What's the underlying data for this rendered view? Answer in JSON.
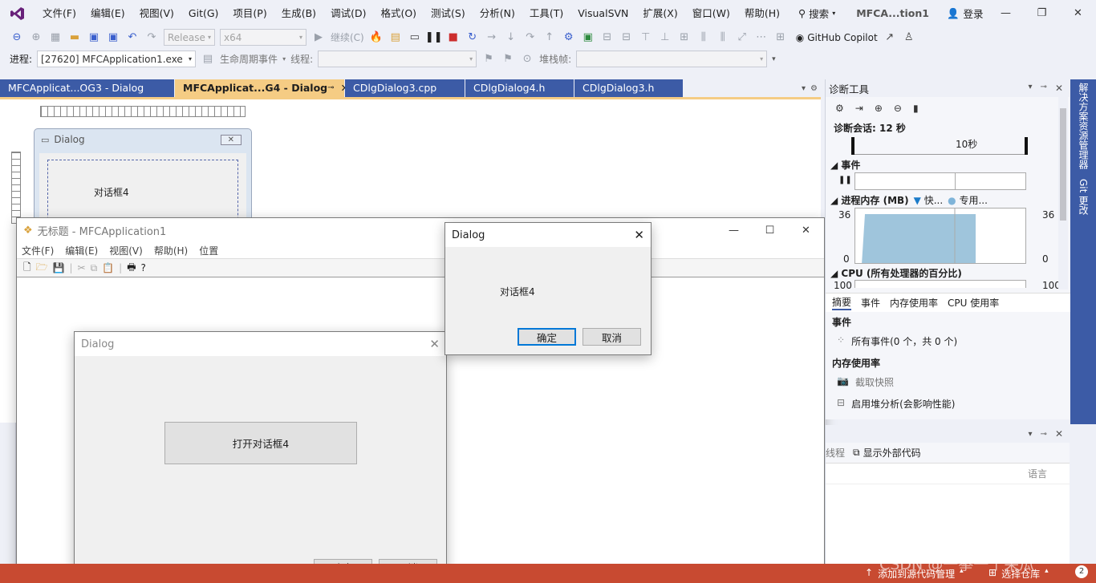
{
  "menu": {
    "items": [
      "文件(F)",
      "编辑(E)",
      "视图(V)",
      "Git(G)",
      "项目(P)",
      "生成(B)",
      "调试(D)",
      "格式(O)",
      "测试(S)",
      "分析(N)",
      "工具(T)",
      "VisualSVN",
      "扩展(X)",
      "窗口(W)",
      "帮助(H)"
    ],
    "search_label": "搜索",
    "solution_title": "MFCA...tion1",
    "login_label": "登录"
  },
  "toolbar": {
    "config": "Release",
    "platform": "x64",
    "continue_label": "继续(C)",
    "copilot_label": "GitHub Copilot"
  },
  "debug_bar": {
    "process_label": "进程:",
    "process_value": "[27620] MFCApplication1.exe",
    "lifecycle_label": "生命周期事件",
    "thread_label": "线程:",
    "stack_label": "堆栈帧:"
  },
  "tabs": [
    {
      "label": "MFCApplicat...OG3 - Dialog",
      "active": false
    },
    {
      "label": "MFCApplicat...G4 - Dialog",
      "active": true
    },
    {
      "label": "CDlgDialog3.cpp",
      "active": false
    },
    {
      "label": "CDlgDialog4.h",
      "active": false
    },
    {
      "label": "CDlgDialog3.h",
      "active": false
    }
  ],
  "designer": {
    "dialog_title": "Dialog",
    "dialog_text": "对话框4"
  },
  "app_window": {
    "title": "无标题 - MFCApplication1",
    "menu": [
      "文件(F)",
      "编辑(E)",
      "视图(V)",
      "帮助(H)",
      "位置"
    ]
  },
  "dialog_main": {
    "title": "Dialog",
    "open_button": "打开对话框4",
    "ok": "确定",
    "cancel": "取消"
  },
  "dialog_small": {
    "title": "Dialog",
    "text": "对话框4",
    "ok": "确定",
    "cancel": "取消"
  },
  "diagnostics": {
    "title": "诊断工具",
    "session": "诊断会话: 12 秒",
    "ruler_label": "10秒",
    "events_label": "事件",
    "memory_label": "进程内存 (MB)",
    "legend_fast": "快...",
    "legend_private": "专用...",
    "mem_max": "36",
    "mem_min": "0",
    "cpu_label": "CPU (所有处理器的百分比)",
    "cpu_max": "100",
    "subtabs": [
      "摘要",
      "事件",
      "内存使用率",
      "CPU 使用率"
    ],
    "events_header": "事件",
    "all_events": "所有事件(0 个，共 0 个)",
    "memory_header": "内存使用率",
    "snapshot": "截取快照",
    "heap": "启用堆分析(会影响性能)"
  },
  "bottom_panel": {
    "thread_label": "线程",
    "external_code": "显示外部代码",
    "language_col": "语言"
  },
  "sidebar": {
    "solution_explorer": "解决方案资源管理器",
    "git_changes": "Git 更改"
  },
  "status": {
    "add_source": "添加到源代码管理",
    "select_repo": "选择仓库",
    "watermark": "CSDN @一拳一个呆瓜",
    "badge": "2"
  },
  "colors": {
    "accent": "#3c5ba6",
    "active_tab": "#f5cc84",
    "status_bar": "#c84a31"
  }
}
